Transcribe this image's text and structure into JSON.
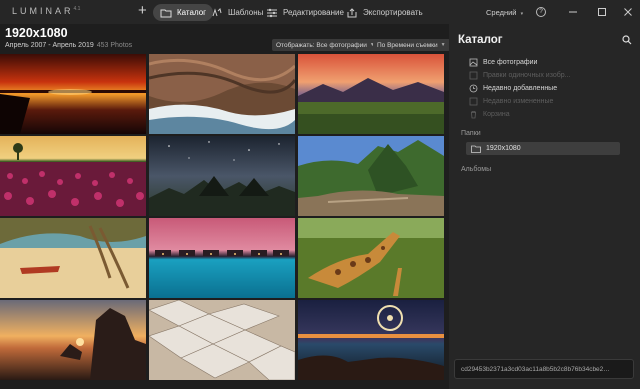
{
  "app": {
    "logo_text": "LUMINAR",
    "logo_version": "4.1",
    "tabs": [
      {
        "label": "Каталог",
        "icon": "folder-icon",
        "active": true
      },
      {
        "label": "Шаблоны",
        "icon": "presets-icon",
        "active": false
      },
      {
        "label": "Редактирование",
        "icon": "sliders-icon",
        "active": false
      },
      {
        "label": "Экспортировать",
        "icon": "export-icon",
        "active": false
      }
    ],
    "quality": "Средний",
    "help_symbol": "?"
  },
  "header": {
    "title": "1920x1080",
    "date_range": "Апрель 2007 - Апрель 2019",
    "count": "453 Photos",
    "show_filter": "Отображать: Все фотографии",
    "sort": "По Времени съемки"
  },
  "photos": [
    {
      "scene": "sunset-pier"
    },
    {
      "scene": "rock-waves"
    },
    {
      "scene": "mountain-lake-dusk"
    },
    {
      "scene": "tulip-field"
    },
    {
      "scene": "starry-volcanoes"
    },
    {
      "scene": "machu-picchu"
    },
    {
      "scene": "beach-boat-tree"
    },
    {
      "scene": "overwater-bungalows"
    },
    {
      "scene": "giraffes"
    },
    {
      "scene": "rock-sunset-coast"
    },
    {
      "scene": "salt-terraces"
    },
    {
      "scene": "ferris-wheel-night"
    }
  ],
  "panel": {
    "title": "Каталог",
    "library": [
      {
        "label": "Все фотографии",
        "icon": "photos-icon",
        "enabled": true
      },
      {
        "label": "Правки одиночных изобр...",
        "icon": "edit-icon",
        "enabled": false
      },
      {
        "label": "Недавно добавленные",
        "icon": "clock-icon",
        "enabled": true
      },
      {
        "label": "Недавно измененные",
        "icon": "edited-icon",
        "enabled": false
      },
      {
        "label": "Корзина",
        "icon": "trash-icon",
        "enabled": false
      }
    ],
    "folders_label": "Папки",
    "folder": "1920x1080",
    "albums_label": "Альбомы",
    "hash": "cd29453b2371a3cd03ac11a8b5b2c8b76b34cbe2d83",
    "hash_more": "..."
  },
  "colors": {
    "background": "#1e1e1e",
    "panel": "#262626",
    "active_tab": "#454545",
    "selected_folder": "#3e3e3e"
  }
}
